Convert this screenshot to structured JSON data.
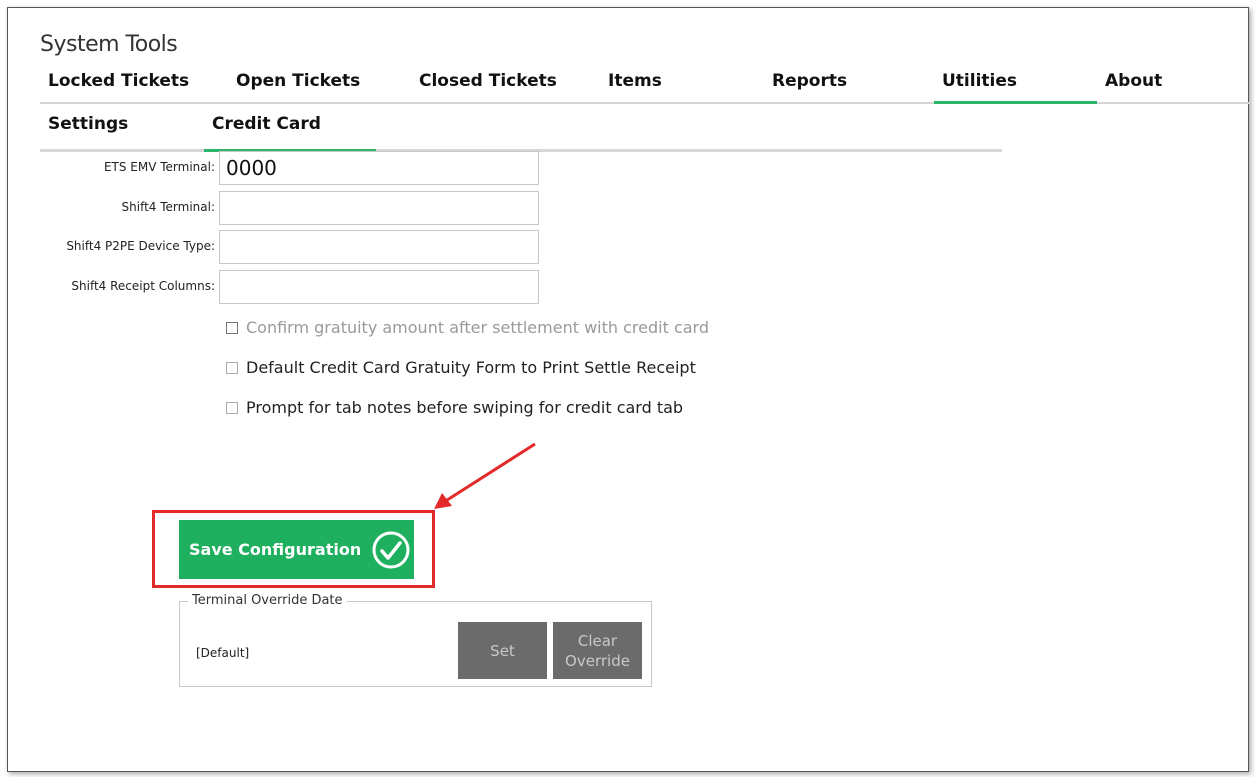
{
  "app": {
    "title": "System Tools"
  },
  "main_tabs": [
    {
      "label": "Locked Tickets",
      "active": false
    },
    {
      "label": "Open Tickets",
      "active": false
    },
    {
      "label": "Closed Tickets",
      "active": false
    },
    {
      "label": "Items",
      "active": false
    },
    {
      "label": "Reports",
      "active": false
    },
    {
      "label": "Utilities",
      "active": true
    },
    {
      "label": "About",
      "active": false
    }
  ],
  "sub_tabs": [
    {
      "label": "Settings",
      "active": false
    },
    {
      "label": "Credit Card",
      "active": true
    }
  ],
  "form": {
    "fields": [
      {
        "label": "ETS EMV Terminal:",
        "value": "0000"
      },
      {
        "label": "Shift4 Terminal:",
        "value": ""
      },
      {
        "label": "Shift4 P2PE Device Type:",
        "value": ""
      },
      {
        "label": "Shift4 Receipt Columns:",
        "value": ""
      }
    ],
    "checkboxes": [
      {
        "label": "Confirm gratuity amount after settlement with credit card",
        "checked": false,
        "disabled": true
      },
      {
        "label": "Default Credit Card Gratuity Form to Print Settle Receipt",
        "checked": false,
        "disabled": false
      },
      {
        "label": "Prompt for tab notes before swiping for credit card tab",
        "checked": false,
        "disabled": false
      }
    ]
  },
  "save_button": {
    "label": "Save Configuration"
  },
  "terminal_override": {
    "legend": "Terminal Override Date",
    "value": "[Default]",
    "set_label": "Set",
    "clear_label_line1": "Clear",
    "clear_label_line2": "Override"
  },
  "colors": {
    "accent_green": "#1fb05f",
    "tab_underline": "#2bb46a",
    "annotation_red": "#e32a2a",
    "disabled_button": "#6b6b6b"
  },
  "icons": {
    "save": "check-circle-icon",
    "annotation": "arrow-icon"
  }
}
